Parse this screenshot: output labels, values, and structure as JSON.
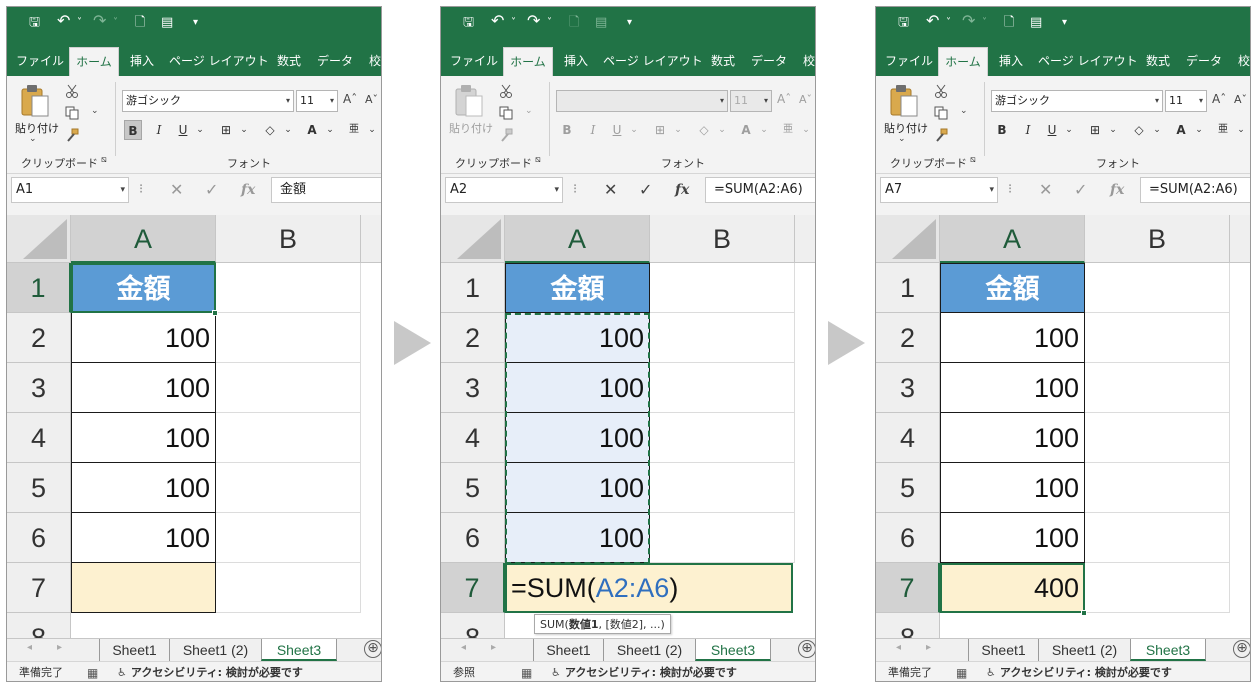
{
  "colors": {
    "excel_green": "#217346",
    "table_header_blue": "#5b9bd5",
    "yellow_cell": "#fdf1d0",
    "range_fill": "#e7eef9",
    "ref_blue": "#2f6fbf",
    "step_arrow": "#c8c8c8"
  },
  "icons": {
    "save": "save-icon",
    "undo": "undo-icon",
    "redo": "redo-icon",
    "print_preview": "print-preview-icon",
    "form": "form-icon",
    "customize": "qat-customize-icon",
    "paste": "clipboard-icon",
    "cut": "scissors-icon",
    "copy": "copy-icon",
    "format_painter": "format-painter-icon",
    "cancel": "cancel-icon",
    "enter": "checkmark-icon",
    "insert_function": "fx-icon",
    "accessibility": "accessibility-icon"
  },
  "qat": {
    "save": "🖫",
    "undo": "↶",
    "undo_dd": "˅",
    "redo": "↷",
    "redo_dd": "˅",
    "print": "🗋",
    "form": "▤",
    "customize": "▾"
  },
  "ribbon_tabs": [
    {
      "label": "ファイル",
      "active": false
    },
    {
      "label": "ホーム",
      "active": true
    },
    {
      "label": "挿入",
      "active": false
    },
    {
      "label": "ページ レイアウト",
      "active": false
    },
    {
      "label": "数式",
      "active": false
    },
    {
      "label": "データ",
      "active": false
    },
    {
      "label": "校",
      "active": false
    }
  ],
  "ribbon": {
    "paste_label": "貼り付け",
    "paste_arrow": "⌄",
    "clipboard_group": "クリップボード",
    "dialog_launcher": "⧅",
    "font_group": "フォント",
    "bold": "B",
    "italic": "I",
    "underline": "U",
    "underline_dd": "⌄",
    "border": "⊞",
    "border_dd": "⌄",
    "fill": "◇",
    "fill_dd": "⌄",
    "font_color": "A",
    "font_color_dd": "⌄",
    "phonetic": "亜",
    "phonetic_dd": "⌄",
    "grow_font": "Aˆ",
    "shrink_font": "Aˇ",
    "copy_dd": "⌄",
    "dd_arrow": "▾"
  },
  "formula_bar": {
    "cancel": "✕",
    "enter": "✓",
    "fx": "fx",
    "dots": "⁝"
  },
  "columns": [
    "A",
    "B"
  ],
  "rows": [
    "1",
    "2",
    "3",
    "4",
    "5",
    "6",
    "7",
    "8"
  ],
  "panels": [
    {
      "name_box": "A1",
      "font_name": "游ゴシック",
      "font_size": "11",
      "formula": "金額",
      "cells": [
        "金額",
        "100",
        "100",
        "100",
        "100",
        "100",
        ""
      ],
      "status": "準備完了"
    },
    {
      "name_box": "A2",
      "font_name": "",
      "font_size": "11",
      "formula": "=SUM(A2:A6)",
      "cells": [
        "金額",
        "100",
        "100",
        "100",
        "100",
        "100",
        ""
      ],
      "editing_formula": {
        "prefix": "=SUM(",
        "ref": "A2:A6",
        "suffix": ")"
      },
      "tooltip": {
        "prefix": "SUM(",
        "bold": "数値1",
        "suffix": ", [数値2], ...)"
      },
      "status": "参照"
    },
    {
      "name_box": "A7",
      "font_name": "游ゴシック",
      "font_size": "11",
      "formula": "=SUM(A2:A6)",
      "cells": [
        "金額",
        "100",
        "100",
        "100",
        "100",
        "100",
        "400"
      ],
      "status": "準備完了"
    }
  ],
  "sheet_tabs": [
    "Sheet1",
    "Sheet1 (2)",
    "Sheet3"
  ],
  "active_sheet": "Sheet3",
  "sheet_nav": {
    "prev": "◂",
    "next": "▸",
    "add": "⊕"
  },
  "status_bar": {
    "macro_icon": "▦",
    "accessibility_icon": "♿︎",
    "accessibility": "アクセシビリティ: 検討が必要です"
  }
}
